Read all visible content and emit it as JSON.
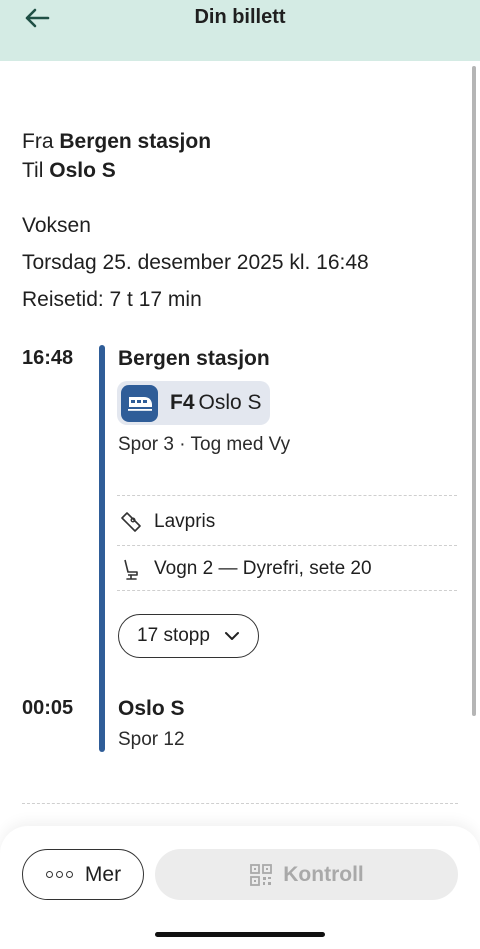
{
  "header": {
    "title": "Din billett",
    "back_icon": "arrow-left-icon"
  },
  "route": {
    "from_label": "Fra",
    "from": "Bergen stasjon",
    "to_label": "Til",
    "to": "Oslo S"
  },
  "ticket": {
    "traveler": "Voksen",
    "date": "Torsdag 25. desember 2025 kl. 16:48",
    "duration": "Reisetid: 7 t 17 min"
  },
  "departure": {
    "time": "16:48",
    "station": "Bergen stasjon",
    "line_id": "F4",
    "destination": "Oslo S",
    "platform_info": "Spor 3 · Tog med Vy"
  },
  "details": {
    "fare": "Lavpris",
    "seat": "Vogn 2 — Dyrefri, sete 20"
  },
  "stops_button": "17 stopp",
  "arrival": {
    "time": "00:05",
    "station": "Oslo S",
    "platform": "Spor 12"
  },
  "actions": {
    "more": "Mer",
    "control": "Kontroll"
  },
  "colors": {
    "header_bg": "#d4ebe4",
    "accent": "#2f5d98"
  }
}
